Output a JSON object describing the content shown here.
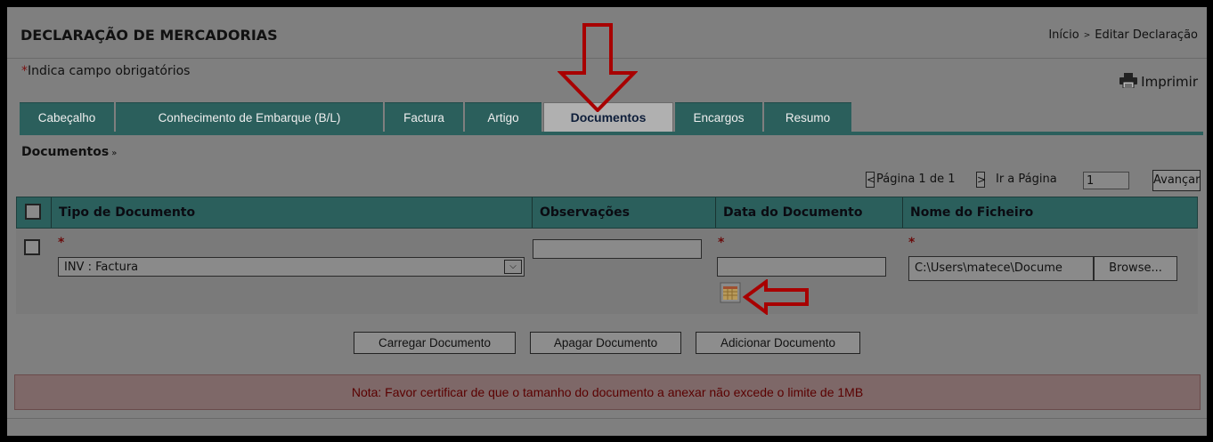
{
  "header": {
    "title": "DECLARAÇÃO DE MERCADORIAS",
    "breadcrumb": {
      "home": "Início",
      "separator": ">",
      "current": "Editar Declaração"
    },
    "required_star": "*",
    "required_note": "Indica campo obrigatórios",
    "print_label": "Imprimir"
  },
  "tabs": [
    {
      "label": "Cabeçalho"
    },
    {
      "label": "Conhecimento de Embarque (B/L)"
    },
    {
      "label": "Factura"
    },
    {
      "label": "Artigo"
    },
    {
      "label": "Documentos"
    },
    {
      "label": "Encargos"
    },
    {
      "label": "Resumo"
    }
  ],
  "section": {
    "title": "Documentos",
    "chevron": "»"
  },
  "pager": {
    "prev": "<",
    "page_text": "Página 1 de 1",
    "next": ">",
    "goto_label": "Ir a Página",
    "goto_value": "1",
    "go_button": "Avançar"
  },
  "table": {
    "headers": {
      "type": "Tipo de Documento",
      "observations": "Observações",
      "date": "Data do Documento",
      "file": "Nome do Ficheiro"
    },
    "row": {
      "star": "*",
      "type_value": "INV : Factura",
      "select_arrow": "⌵",
      "observations_value": "",
      "date_value": "",
      "file_value": "C:\\Users\\matece\\Docume",
      "browse_label": "Browse..."
    }
  },
  "actions": {
    "upload": "Carregar Documento",
    "delete": "Apagar Documento",
    "add": "Adicionar Documento"
  },
  "note": "Nota: Favor certificar de que o tamanho do documento a anexar não excede o limite de 1MB",
  "colors": {
    "tab_bg": "#2b5f5c",
    "arrow": "#a80000",
    "note_text": "#5a0000",
    "background": "#7f7f7f"
  }
}
